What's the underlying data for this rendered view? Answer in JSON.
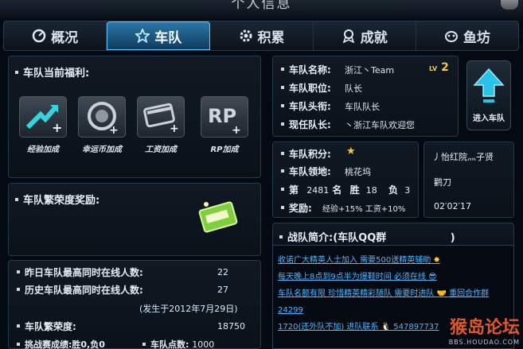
{
  "window": {
    "title": "个人信息"
  },
  "tabs": [
    {
      "label": "概况",
      "icon": "speedometer-icon"
    },
    {
      "label": "车队",
      "icon": "star-icon"
    },
    {
      "label": "积累",
      "icon": "gear-icon"
    },
    {
      "label": "成就",
      "icon": "medal-icon"
    },
    {
      "label": "鱼坊",
      "icon": "fish-icon"
    }
  ],
  "benefits": {
    "title": "车队当前福利:",
    "items": [
      {
        "label": "经验加成",
        "icon": "exp-arrow-icon"
      },
      {
        "label": "幸运币加成",
        "icon": "lucky-coin-icon"
      },
      {
        "label": "工资加成",
        "icon": "salary-card-icon"
      },
      {
        "label": "RP加成",
        "icon": "rp-plus-icon"
      }
    ]
  },
  "prosperity_reward": {
    "title": "车队繁荣度奖励:"
  },
  "stats": {
    "max_online_yesterday_label": "昨日车队最高同时在线人数:",
    "max_online_yesterday_value": "22",
    "max_online_history_label": "历史车队最高同时在线人数:",
    "max_online_history_value": "27",
    "history_date": "(发生于2012年7月29日)",
    "prosperity_label": "车队繁荣度:",
    "prosperity_value": "18750",
    "challenge_text": "挑战赛成绩:胜0,负0",
    "points_label": "车队点数:",
    "points_value": "1000"
  },
  "team": {
    "name_label": "车队名称:",
    "name_value": "浙江丶Team",
    "level_prefix": "LV",
    "level_value": "2",
    "position_label": "车队职位:",
    "position_value": "队长",
    "title_label": "车队头衔:",
    "title_value": "车队队长",
    "leader_label": "现任队长:",
    "leader_value": "丶浙江车队欢迎您",
    "score_label": "车队积分:",
    "territory_label": "车队领地:",
    "territory_value": "桃花坞",
    "rank_prefix": "第",
    "rank_value": "2481",
    "rank_suffix": "名",
    "wins_label": "胜",
    "wins_value": "18",
    "losses_label": "负",
    "losses_value": "3",
    "reward_label": "奖励:",
    "reward_value": "经验+15% 工资+10%",
    "side_name": "丿怡红院灬子贤",
    "side_item": "鹳刀",
    "side_time": "02′02′17",
    "join_label": "进入车队"
  },
  "intro": {
    "title": "战队简介:(车队QQ群",
    "title_end": ")",
    "text_1": "收诺广大精英人士加入 需要500送精英辅助",
    "text_2": "每天晚上8点到9点半为爆鞋时间 必须在线",
    "text_3": "车队名额有限 珍惜精英精彩随队 需要时进队",
    "text_4": "重回合作群24299",
    "text_5": "1720(还外队不加) 进队联系",
    "text_6": "547897737"
  },
  "watermark": {
    "main": "猴岛论坛",
    "sub": "BBS.HOUDAO.COM"
  },
  "colors": {
    "accent": "#5cc7ff",
    "link": "#4fb6ff",
    "bg": "#050a12"
  }
}
